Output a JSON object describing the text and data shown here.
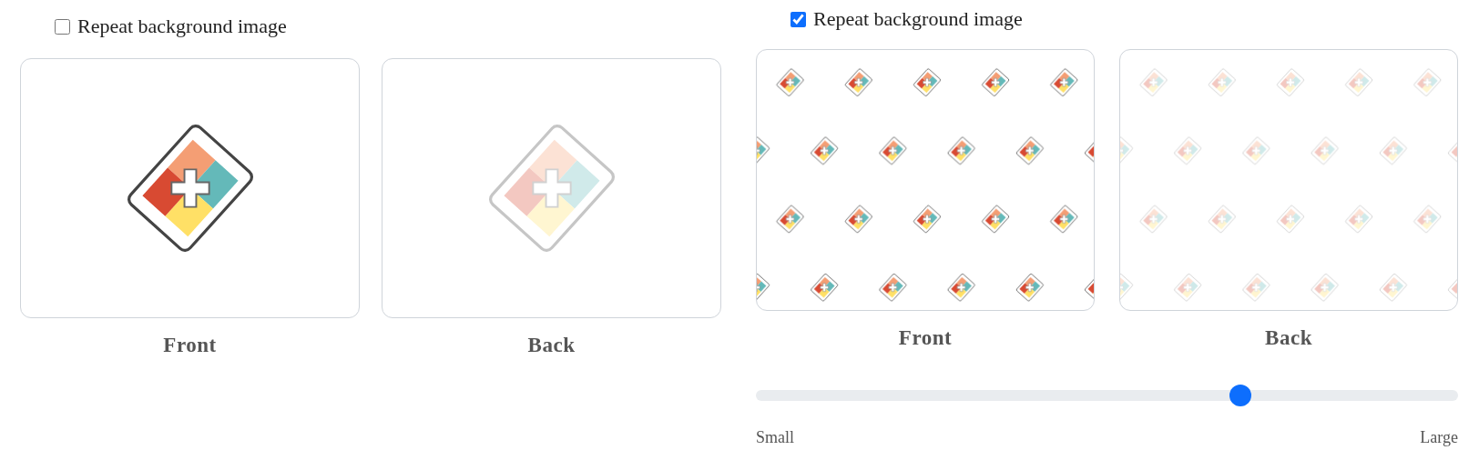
{
  "panels": [
    {
      "repeat": {
        "label": "Repeat background image",
        "checked": false
      },
      "cards": [
        {
          "kind": "front",
          "label": "Front"
        },
        {
          "kind": "back",
          "label": "Back"
        }
      ]
    },
    {
      "repeat": {
        "label": "Repeat background image",
        "checked": true
      },
      "cards": [
        {
          "kind": "front",
          "label": "Front"
        },
        {
          "kind": "back",
          "label": "Back"
        }
      ],
      "slider": {
        "level": 0.69,
        "min_label": "Small",
        "max_label": "Large"
      }
    }
  ]
}
